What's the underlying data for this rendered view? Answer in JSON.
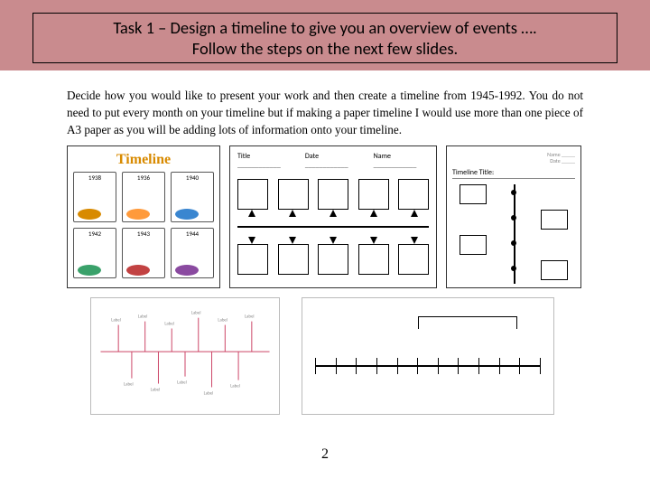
{
  "header": {
    "title_line1": "Task 1 – Design a timeline to give you an overview of events ….",
    "title_line2": "Follow the steps on the next few slides."
  },
  "instruction": "Decide how you would like to present your work and then create a timeline from 1945-1992. You do not need to put every month on your timeline but if making a paper timeline I would use more than one piece of A3 paper as you will be adding lots of information onto your timeline.",
  "exA": {
    "heading": "Timeline",
    "cells": [
      {
        "year": "1938",
        "color": "#d88a00"
      },
      {
        "year": "1936",
        "color": "#ff9a3b"
      },
      {
        "year": "1940",
        "color": "#3a86d0"
      },
      {
        "year": "1942",
        "color": "#3aa16a"
      },
      {
        "year": "1943",
        "color": "#c24242"
      },
      {
        "year": "1944",
        "color": "#8a4aa0"
      }
    ]
  },
  "exB": {
    "labels": [
      "Title",
      "Date",
      "Name"
    ]
  },
  "exC": {
    "meta1": "Name _____",
    "meta2": "Date _____",
    "title_label": "Timeline Title:"
  },
  "page_number": "2"
}
